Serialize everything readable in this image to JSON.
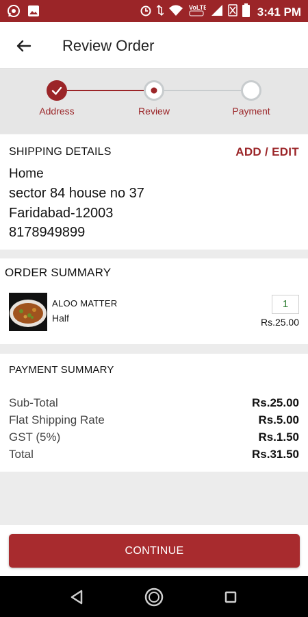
{
  "status_bar": {
    "time": "3:41 PM",
    "left_icons": [
      "whatsapp-icon",
      "image-icon"
    ],
    "right_icons": [
      "alarm-icon",
      "data-arrows-icon",
      "wifi-icon",
      "volte-icon",
      "signal-icon",
      "no-sim-icon",
      "battery-icon"
    ],
    "volte_label": "VoLTE"
  },
  "app_bar": {
    "title": "Review Order",
    "back_icon": "arrow-left-icon"
  },
  "stepper": {
    "steps": [
      {
        "label": "Address",
        "state": "completed"
      },
      {
        "label": "Review",
        "state": "current"
      },
      {
        "label": "Payment",
        "state": "pending"
      }
    ],
    "active_color": "#9b2528",
    "inactive_color": "#c8ccce"
  },
  "shipping": {
    "heading": "SHIPPING DETAILS",
    "action": "ADD / EDIT",
    "name": "Home",
    "line1": "sector 84 house no 37",
    "line2": "Faridabad-12003",
    "phone": "8178949899"
  },
  "order_summary": {
    "heading": "ORDER SUMMARY",
    "items": [
      {
        "name": "ALOO MATTER",
        "variant": "Half",
        "quantity": "1",
        "price": "Rs.25.00"
      }
    ]
  },
  "payment_summary": {
    "heading": "PAYMENT SUMMARY",
    "rows": [
      {
        "label": "Sub-Total",
        "value": "Rs.25.00"
      },
      {
        "label": "Flat Shipping Rate",
        "value": "Rs.5.00"
      },
      {
        "label": "GST (5%)",
        "value": "Rs.1.50"
      },
      {
        "label": "Total",
        "value": "Rs.31.50"
      }
    ]
  },
  "continue_button": {
    "label": "CONTINUE",
    "color": "#a82b2e"
  },
  "nav_bar": {
    "icons": [
      "back-triangle-icon",
      "home-circle-icon",
      "recents-square-icon"
    ]
  }
}
